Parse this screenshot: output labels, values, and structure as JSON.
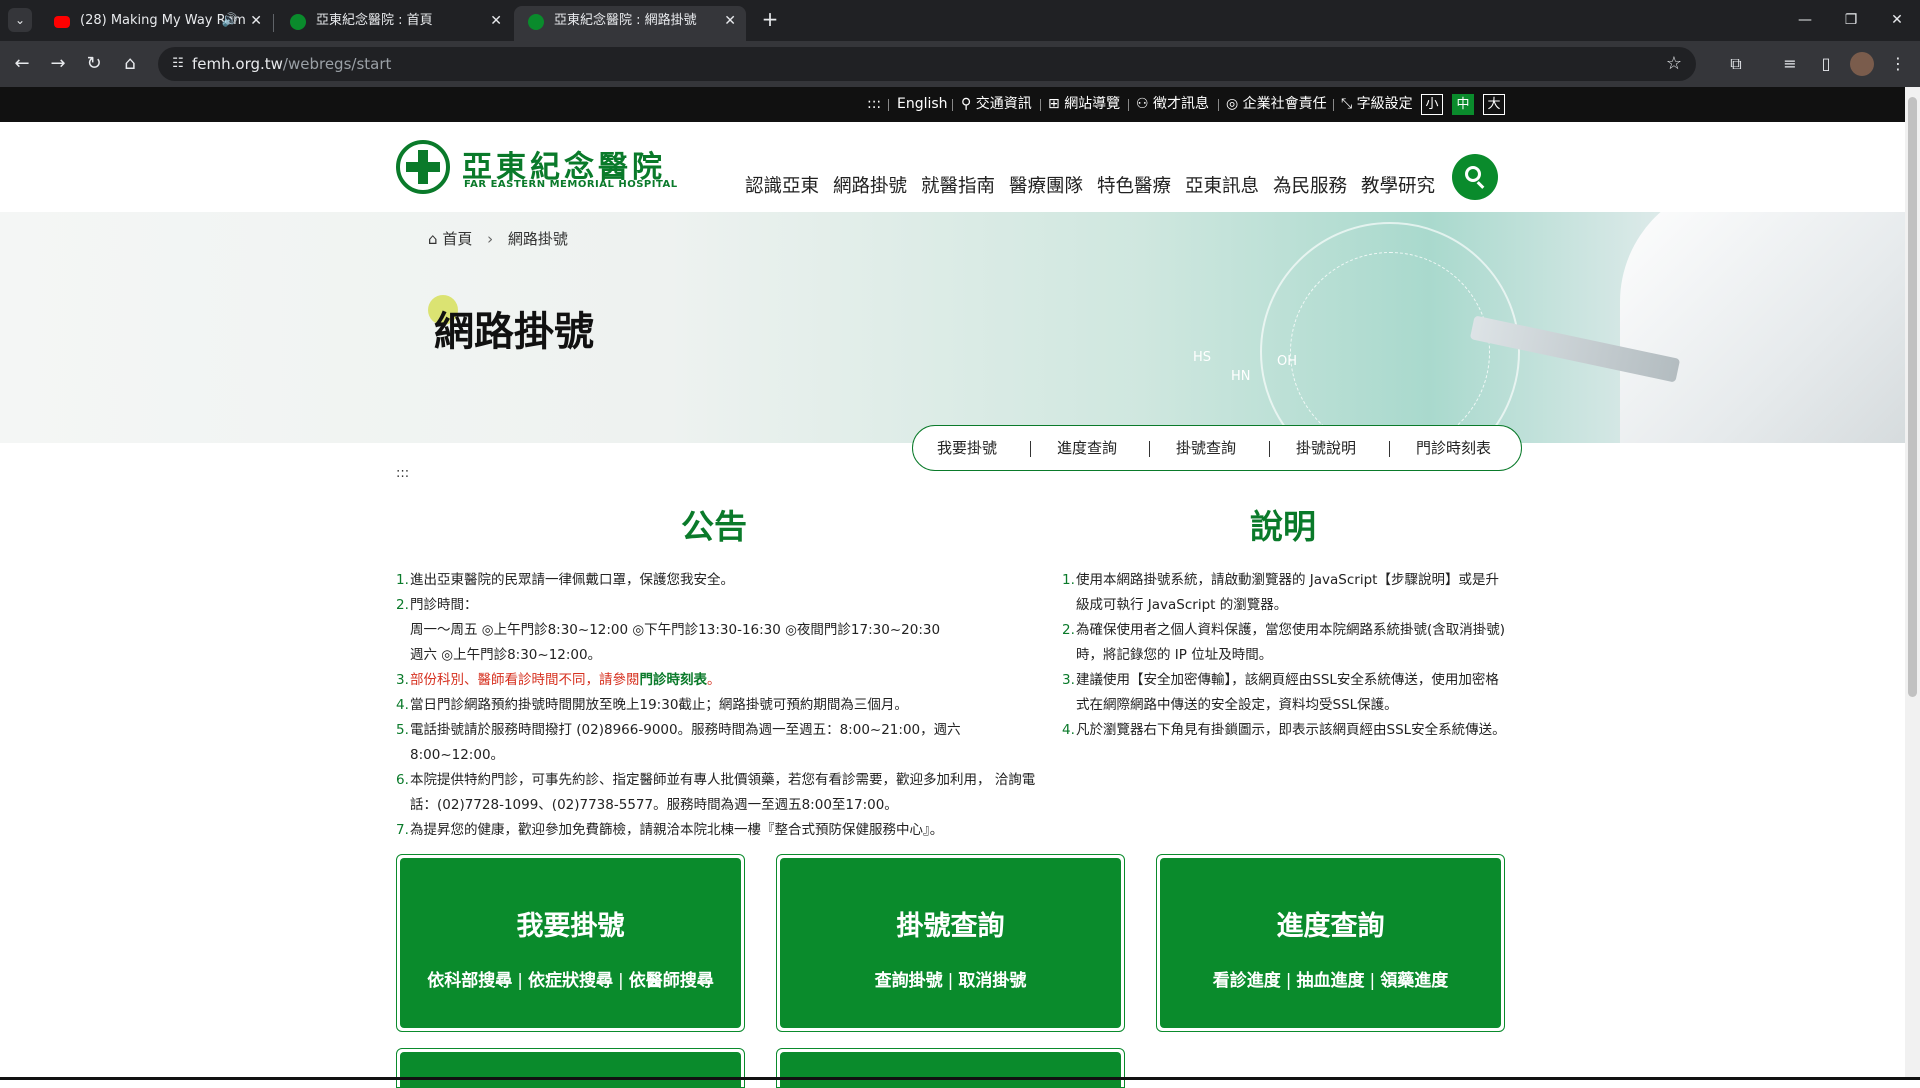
{
  "browser": {
    "tabs": [
      {
        "title": "(28) Making My Way Rem",
        "favicon": "youtube-icon",
        "audio": true,
        "active": false
      },
      {
        "title": "亞東紀念醫院 : 首頁",
        "favicon": "hospital-icon",
        "audio": false,
        "active": false
      },
      {
        "title": "亞東紀念醫院 : 網路掛號",
        "favicon": "hospital-icon",
        "audio": false,
        "active": true
      }
    ],
    "url_host": "femh.org.tw",
    "url_path": "/webregs/start",
    "colors": {
      "tabbar": "#202124",
      "toolbar": "#35363a"
    }
  },
  "utility": {
    "accesskey": ":::",
    "english": "English",
    "traffic": "交通資訊",
    "sitemap": "網站導覽",
    "careers": "徵才訊息",
    "csr": "企業社會責任",
    "font_setting": "字級設定",
    "font_small": "小",
    "font_medium": "中",
    "font_large": "大",
    "font_selected": "中"
  },
  "header": {
    "logo_cn": "亞東紀念醫院",
    "logo_en": "FAR EASTERN MEMORIAL HOSPITAL",
    "nav": [
      "認識亞東",
      "網路掛號",
      "就醫指南",
      "醫療團隊",
      "特色醫療",
      "亞東訊息",
      "為民服務",
      "教學研究"
    ],
    "brand_color": "#0a8b2c"
  },
  "banner": {
    "breadcrumb_home": "首頁",
    "breadcrumb_current": "網路掛號",
    "title": "網路掛號",
    "image_labels": {
      "hs": "HS",
      "hn": "HN",
      "oh": "OH"
    }
  },
  "subnav": [
    "我要掛號",
    "進度查詢",
    "掛號查詢",
    "掛號說明",
    "門診時刻表"
  ],
  "content": {
    "accesskey": ":::",
    "notice_title": "公告",
    "desc_title": "說明",
    "notice": {
      "n1": "1.",
      "t1": "進出亞東醫院的民眾請一律佩戴口罩，保護您我安全。",
      "n2": "2.",
      "t2": "門診時間：",
      "t2a": "周一～周五 ◎上午門診8:30~12:00 ◎下午門診13:30-16:30 ◎夜間門診17:30~20:30",
      "t2b": "週六 ◎上午門診8:30~12:00。",
      "n3": "3.",
      "t3_red": "部份科別、醫師看診時間不同，請參閱",
      "t3_link": "門診時刻表",
      "t3_end": "。",
      "n4": "4.",
      "t4": "當日門診網路預約掛號時間開放至晚上19:30截止；網路掛號可預約期間為三個月。",
      "n5": "5.",
      "t5": "電話掛號請於服務時間撥打 (02)8966-9000。服務時間為週一至週五：8:00~21:00，週六 8:00~12:00。",
      "n6": "6.",
      "t6": "本院提供特約門診，可事先約診、指定醫師並有專人批價領藥，若您有看診需要，歡迎多加利用， 洽詢電話：(02)7728-1099、(02)7738-5577。服務時間為週一至週五8:00至17:00。",
      "n7": "7.",
      "t7": "為提昇您的健康，歡迎參加免費篩檢，請親洽本院北棟一樓『整合式預防保健服務中心』。"
    },
    "desc": {
      "n1": "1.",
      "t1": "使用本網路掛號系統，請啟動瀏覽器的 JavaScript【步驟說明】或是升級成可執行 JavaScript 的瀏覽器。",
      "n2": "2.",
      "t2": "為確保使用者之個人資料保護，當您使用本院網路系統掛號(含取消掛號)時，將記錄您的 IP 位址及時間。",
      "n3": "3.",
      "t3": "建議使用【安全加密傳輸】，該網頁經由SSL安全系統傳送，使用加密格式在網際網路中傳送的安全設定，資料均受SSL保護。",
      "n4": "4.",
      "t4": "凡於瀏覽器右下角見有掛鎖圖示，即表示該網頁經由SSL安全系統傳送。"
    },
    "cards": [
      {
        "title": "我要掛號",
        "links": [
          "依科部搜尋",
          "依症狀搜尋",
          "依醫師搜尋"
        ]
      },
      {
        "title": "掛號查詢",
        "links": [
          "查詢掛號",
          "取消掛號"
        ]
      },
      {
        "title": "進度查詢",
        "links": [
          "看診進度",
          "抽血進度",
          "領藥進度"
        ]
      }
    ],
    "separator": "|"
  }
}
